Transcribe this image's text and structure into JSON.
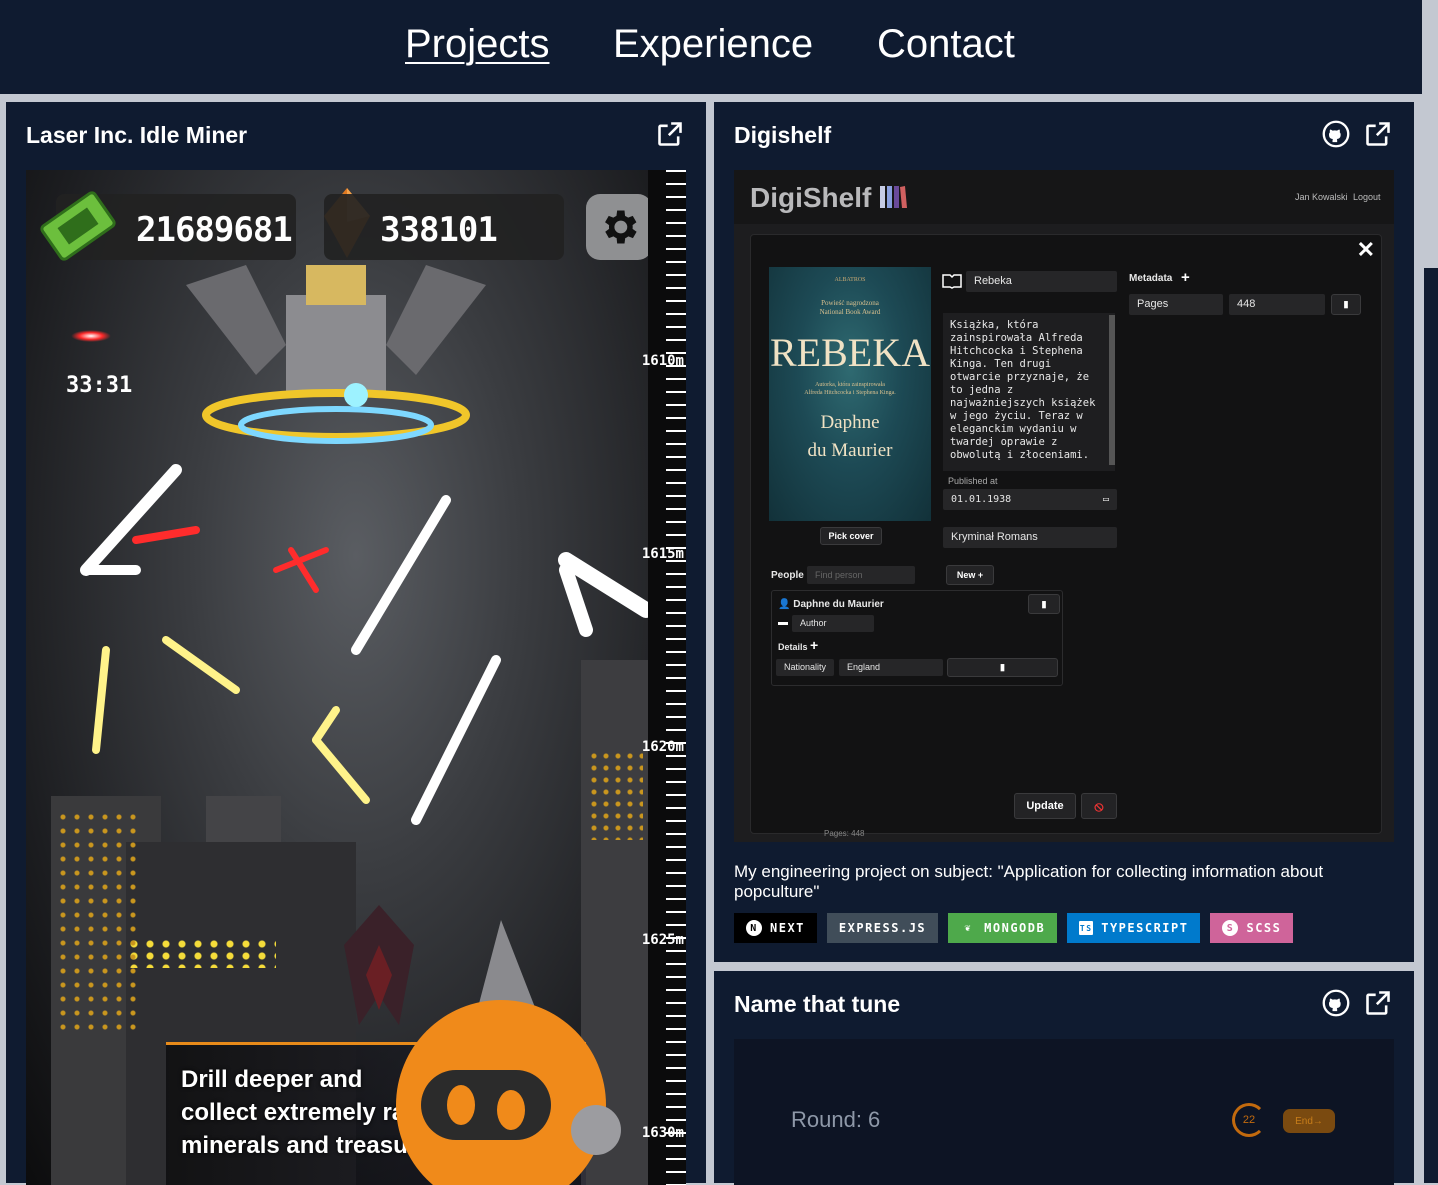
{
  "nav": {
    "links": [
      {
        "label": "Projects",
        "active": true
      },
      {
        "label": "Experience",
        "active": false
      },
      {
        "label": "Contact",
        "active": false
      }
    ]
  },
  "colors": {
    "background": "#0f1b30",
    "page_gap": "#c3c8d1",
    "accent_orange": "#e88b1a"
  },
  "projects": [
    {
      "title": "Laser Inc. Idle Miner",
      "icons": [
        "external-link-icon"
      ],
      "game": {
        "money": "21689681",
        "crystals": "338101",
        "timer": "33:31",
        "depth_ticks": [
          "1610m",
          "1615m",
          "1620m",
          "1625m",
          "1630m"
        ],
        "promo_lines": [
          "Drill deeper and",
          "collect extremely rare",
          "minerals and treasures!"
        ]
      }
    },
    {
      "title": "Digishelf",
      "icons": [
        "github-icon",
        "external-link-icon"
      ],
      "app": {
        "logo": "DigiShelf",
        "user": "Jan Kowalski",
        "logout": "Logout",
        "book_title": "Rebeka",
        "description": "Książka, która\nzainspirowała Alfreda\nHitchcocka i Stephena\nKinga. Ten drugi\notwarcie przyznaje, że\nto jedna z\nnajważniejszych książek\nw jego życiu. Teraz w\neleganckim wydaniu w\ntwardej oprawie z\nobwolutą i złoceniami.",
        "published_label": "Published at",
        "published_value": "01.01.1938",
        "genre": "Kryminał Romans",
        "pick_cover": "Pick cover",
        "metadata_label": "Metadata",
        "metadata": [
          {
            "key": "Pages",
            "value": "448"
          }
        ],
        "people_label": "People",
        "find_person_placeholder": "Find person",
        "new_label": "New",
        "person_name": "Daphne du Maurier",
        "person_role": "Author",
        "details_label": "Details",
        "details": [
          {
            "key": "Nationality",
            "value": "England"
          }
        ],
        "update_label": "Update",
        "footer_hint": "Pages: 448",
        "cover": {
          "publisher": "ALBATROS",
          "award": "Powieść nagrodzona\nNational Book Award",
          "title": "REBEKA",
          "blurb": "Autorka, która zainspirowała\nAlfreda Hitchcocka i Stephena Kinga.",
          "author": "Daphne\ndu Maurier"
        }
      },
      "description": "My engineering project on subject: \"Application for collecting information about popculture\"",
      "tech": [
        {
          "label": "NEXT",
          "color": "#000000",
          "icon": "N"
        },
        {
          "label": "EXPRESS.JS",
          "color": "#404d59",
          "icon": ""
        },
        {
          "label": "MONGODB",
          "color": "#4ea94b",
          "icon": "leaf"
        },
        {
          "label": "TYPESCRIPT",
          "color": "#007acc",
          "icon": "TS"
        },
        {
          "label": "SCSS",
          "color": "#cf649a",
          "icon": "sass"
        }
      ]
    },
    {
      "title": "Name that tune",
      "icons": [
        "github-icon",
        "external-link-icon"
      ],
      "app": {
        "round": "Round: 6",
        "timer": "22",
        "end": "End"
      }
    }
  ]
}
